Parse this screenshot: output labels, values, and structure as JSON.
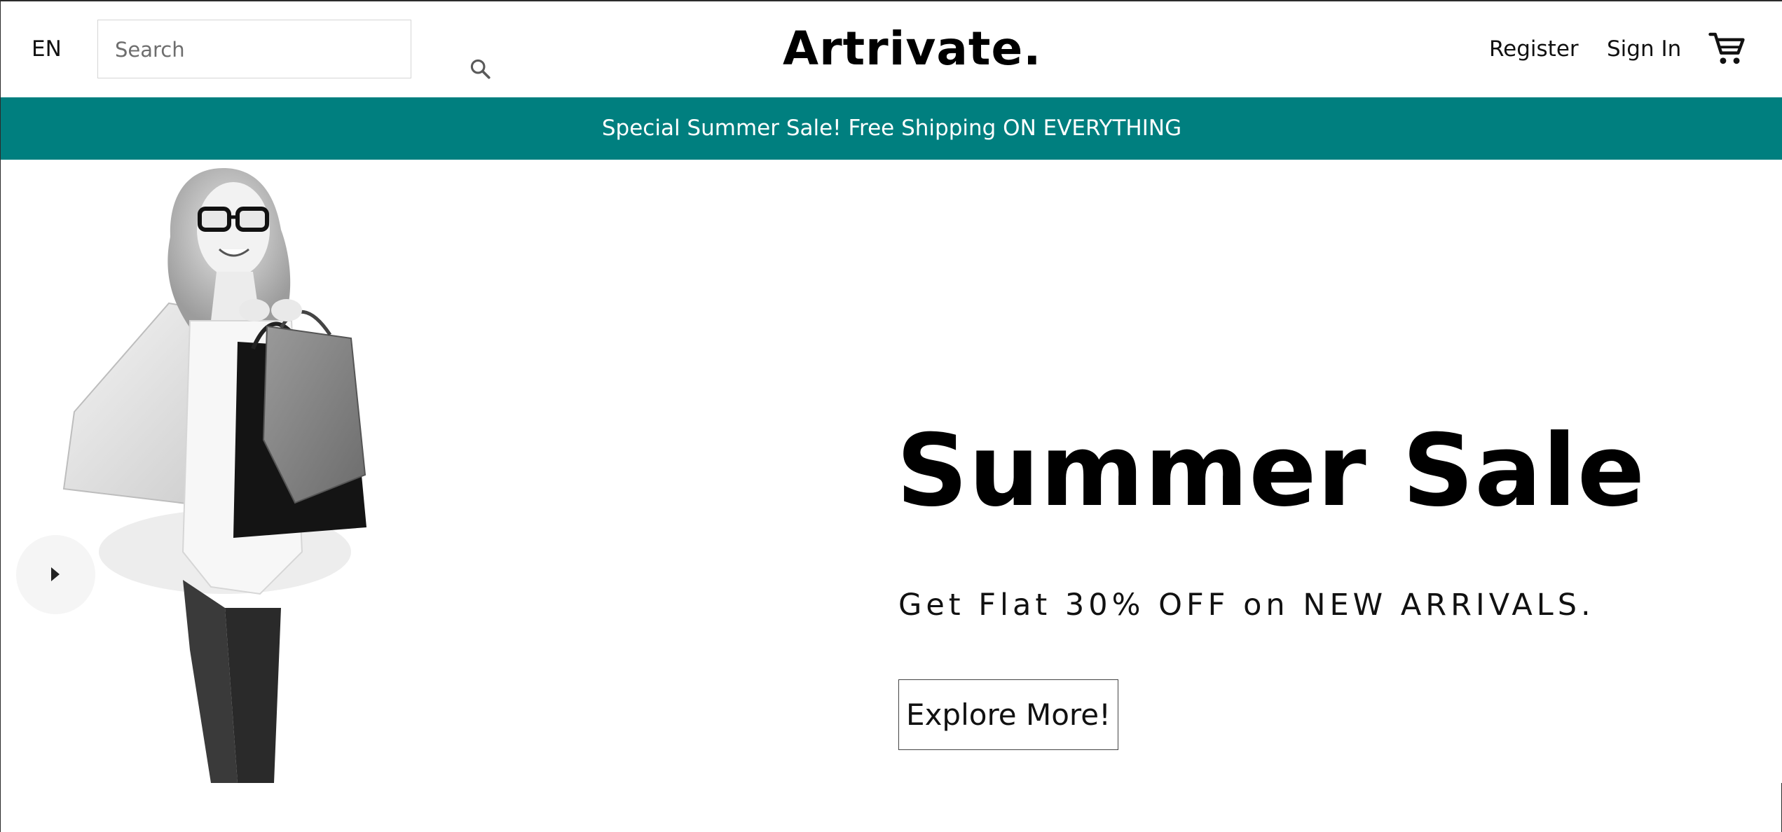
{
  "header": {
    "language": "EN",
    "search": {
      "placeholder": "Search",
      "value": "",
      "icon": "search-icon"
    },
    "logo": "Artrivate.",
    "links": {
      "register": "Register",
      "sign_in": "Sign In"
    },
    "cart_icon": "shopping-cart-icon"
  },
  "announcement": {
    "text": "Special Summer Sale! Free Shipping ON EVERYTHING",
    "background_color": "#007f7f",
    "text_color": "#ffffff"
  },
  "hero": {
    "image": "woman-with-shopping-bags-image",
    "title": "Summer Sale",
    "subtitle": "Get Flat 30% OFF on NEW ARRIVALS.",
    "cta_label": "Explore More!",
    "slider_arrow_icon": "caret-right-icon"
  }
}
